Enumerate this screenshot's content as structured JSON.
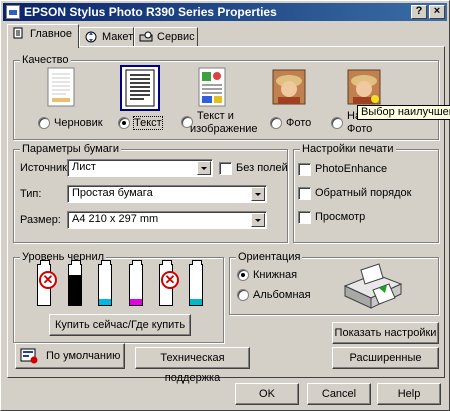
{
  "window": {
    "title": "EPSON Stylus Photo R390 Series Properties",
    "controls": {
      "minimize": "",
      "help": "?",
      "close": "×"
    }
  },
  "tabs": [
    {
      "label": "Главное",
      "icon": "printer-page-icon",
      "active": true
    },
    {
      "label": "Макет",
      "icon": "layout-icon",
      "active": false
    },
    {
      "label": "Сервис",
      "icon": "service-icon",
      "active": false
    }
  ],
  "quality": {
    "group_label": "Качество",
    "options": [
      {
        "label": "Черновик",
        "selected": false,
        "icon": "draft-page-icon"
      },
      {
        "label": "Текст",
        "selected": true,
        "icon": "text-page-icon"
      },
      {
        "label_line1": "Текст и",
        "label_line2": "изображение",
        "selected": false,
        "icon": "text-image-page-icon"
      },
      {
        "label": "Фото",
        "selected": false,
        "icon": "photo-icon"
      },
      {
        "label_line1": "На",
        "label_line2": "Фото",
        "selected": false,
        "icon": "best-photo-icon"
      }
    ],
    "tooltip": "Выбор наилучшей, ф"
  },
  "paper": {
    "group_label": "Параметры бумаги",
    "source_label": "Источник:",
    "source_value": "Лист",
    "borderless_label": "Без полей",
    "borderless_checked": false,
    "type_label": "Тип:",
    "type_value": "Простая бумага",
    "size_label": "Размер:",
    "size_value": "A4 210 x 297 mm"
  },
  "print_settings": {
    "group_label": "Настройки печати",
    "items": [
      {
        "label": "PhotoEnhance",
        "checked": false
      },
      {
        "label": "Обратный порядок",
        "checked": false
      },
      {
        "label": "Просмотр",
        "checked": false
      }
    ]
  },
  "ink": {
    "group_label": "Уровень чернил",
    "cartridges": [
      {
        "color": "#000000",
        "level": 0.0,
        "empty": true
      },
      {
        "color": "#000000",
        "level": 0.75,
        "empty": false
      },
      {
        "color": "#00b8e6",
        "level": 0.15,
        "empty": false
      },
      {
        "color": "#e000e0",
        "level": 0.15,
        "empty": false
      },
      {
        "color": "#f0e000",
        "level": 0.0,
        "empty": true
      },
      {
        "color": "#00b8c8",
        "level": 0.15,
        "empty": false
      }
    ],
    "buy_button": "Купить сейчас/Где купить"
  },
  "orientation": {
    "group_label": "Ориентация",
    "portrait": "Книжная",
    "landscape": "Альбомная",
    "selected": "portrait"
  },
  "buttons": {
    "defaults": "По умолчанию",
    "support": "Техническая поддержка",
    "show_settings": "Показать настройки",
    "advanced": "Расширенные",
    "ok": "OK",
    "cancel": "Cancel",
    "help": "Help"
  }
}
